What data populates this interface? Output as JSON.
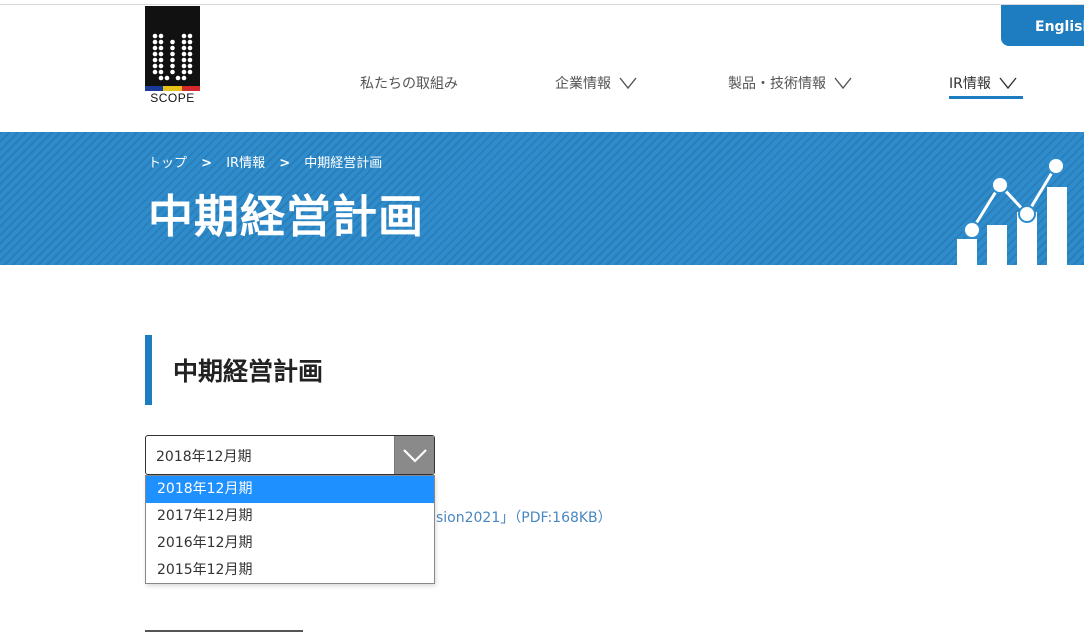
{
  "logo": {
    "text": "SCOPE",
    "stripe_colors": [
      "#1a3a9a",
      "#e8c21a",
      "#d42a2a"
    ]
  },
  "header": {
    "english_label": "English",
    "nav": [
      {
        "label": "私たちの取組み",
        "has_chevron": false
      },
      {
        "label": "企業情報",
        "has_chevron": true
      },
      {
        "label": "製品・技術情報",
        "has_chevron": true
      },
      {
        "label": "IR情報",
        "has_chevron": true,
        "active": true
      }
    ]
  },
  "banner": {
    "breadcrumb": [
      "トップ",
      "IR情報",
      "中期経営計画"
    ],
    "separator": ">",
    "title": "中期経営計画",
    "color": "#2f8ccc"
  },
  "section": {
    "title": "中期経営計画"
  },
  "period_select": {
    "value": "2018年12月期",
    "options": [
      "2018年12月期",
      "2017年12月期",
      "2016年12月期",
      "2015年12月期"
    ],
    "highlighted_index": 0
  },
  "links": {
    "pdf_partial": "sion2021」（PDF:168KB）"
  },
  "colors": {
    "accent": "#1e7cc1",
    "highlight": "#1e90ff",
    "link": "#4a86c0"
  }
}
